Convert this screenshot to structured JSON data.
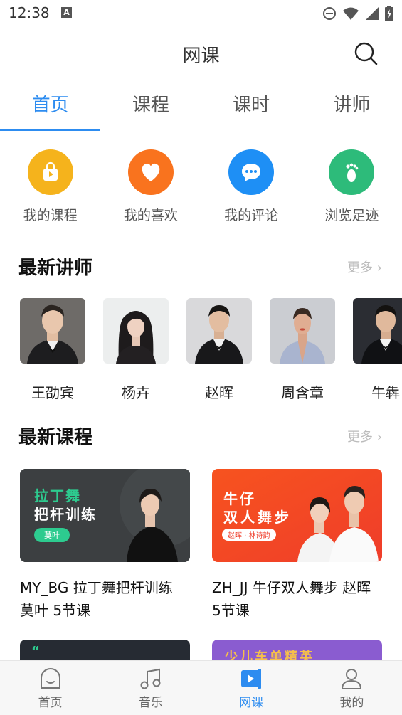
{
  "status_bar": {
    "time": "12:38",
    "notif_badge": "A"
  },
  "header": {
    "title": "网课"
  },
  "tabs": [
    {
      "label": "首页",
      "active": true
    },
    {
      "label": "课程",
      "active": false
    },
    {
      "label": "课时",
      "active": false
    },
    {
      "label": "讲师",
      "active": false
    }
  ],
  "quick_actions": [
    {
      "label": "我的课程",
      "icon": "shopping-bag-icon",
      "color": "#f5b31c"
    },
    {
      "label": "我的喜欢",
      "icon": "heart-icon",
      "color": "#f9731e"
    },
    {
      "label": "我的评论",
      "icon": "comment-icon",
      "color": "#1e8ff5"
    },
    {
      "label": "浏览足迹",
      "icon": "footprint-icon",
      "color": "#2dbb7a"
    }
  ],
  "teachers_section": {
    "title": "最新讲师",
    "more": "更多"
  },
  "teachers": [
    {
      "name": "王劭宾"
    },
    {
      "name": "杨卉"
    },
    {
      "name": "赵晖"
    },
    {
      "name": "周含章"
    },
    {
      "name": "牛犇"
    }
  ],
  "courses_section": {
    "title": "最新课程",
    "more": "更多"
  },
  "courses": [
    {
      "title": "MY_BG 拉丁舞把杆训练 莫叶 5节课",
      "banner_line1": "拉丁舞",
      "banner_line2": "把杆训练",
      "banner_tag": "莫叶"
    },
    {
      "title": "ZH_JJ 牛仔双人舞步 赵晖 5节课",
      "banner_line1": "牛仔",
      "banner_line2": "双人舞步",
      "banner_tag": "赵晖 · 林诗韵"
    }
  ],
  "partial_courses": [
    {
      "banner_text": ""
    },
    {
      "banner_text": "少儿车单精英"
    }
  ],
  "bottom_nav": [
    {
      "label": "首页",
      "icon": "home-icon",
      "active": false
    },
    {
      "label": "音乐",
      "icon": "music-note-icon",
      "active": false
    },
    {
      "label": "网课",
      "icon": "video-course-icon",
      "active": true
    },
    {
      "label": "我的",
      "icon": "profile-icon",
      "active": false
    }
  ],
  "colors": {
    "accent": "#2d8cf0"
  }
}
